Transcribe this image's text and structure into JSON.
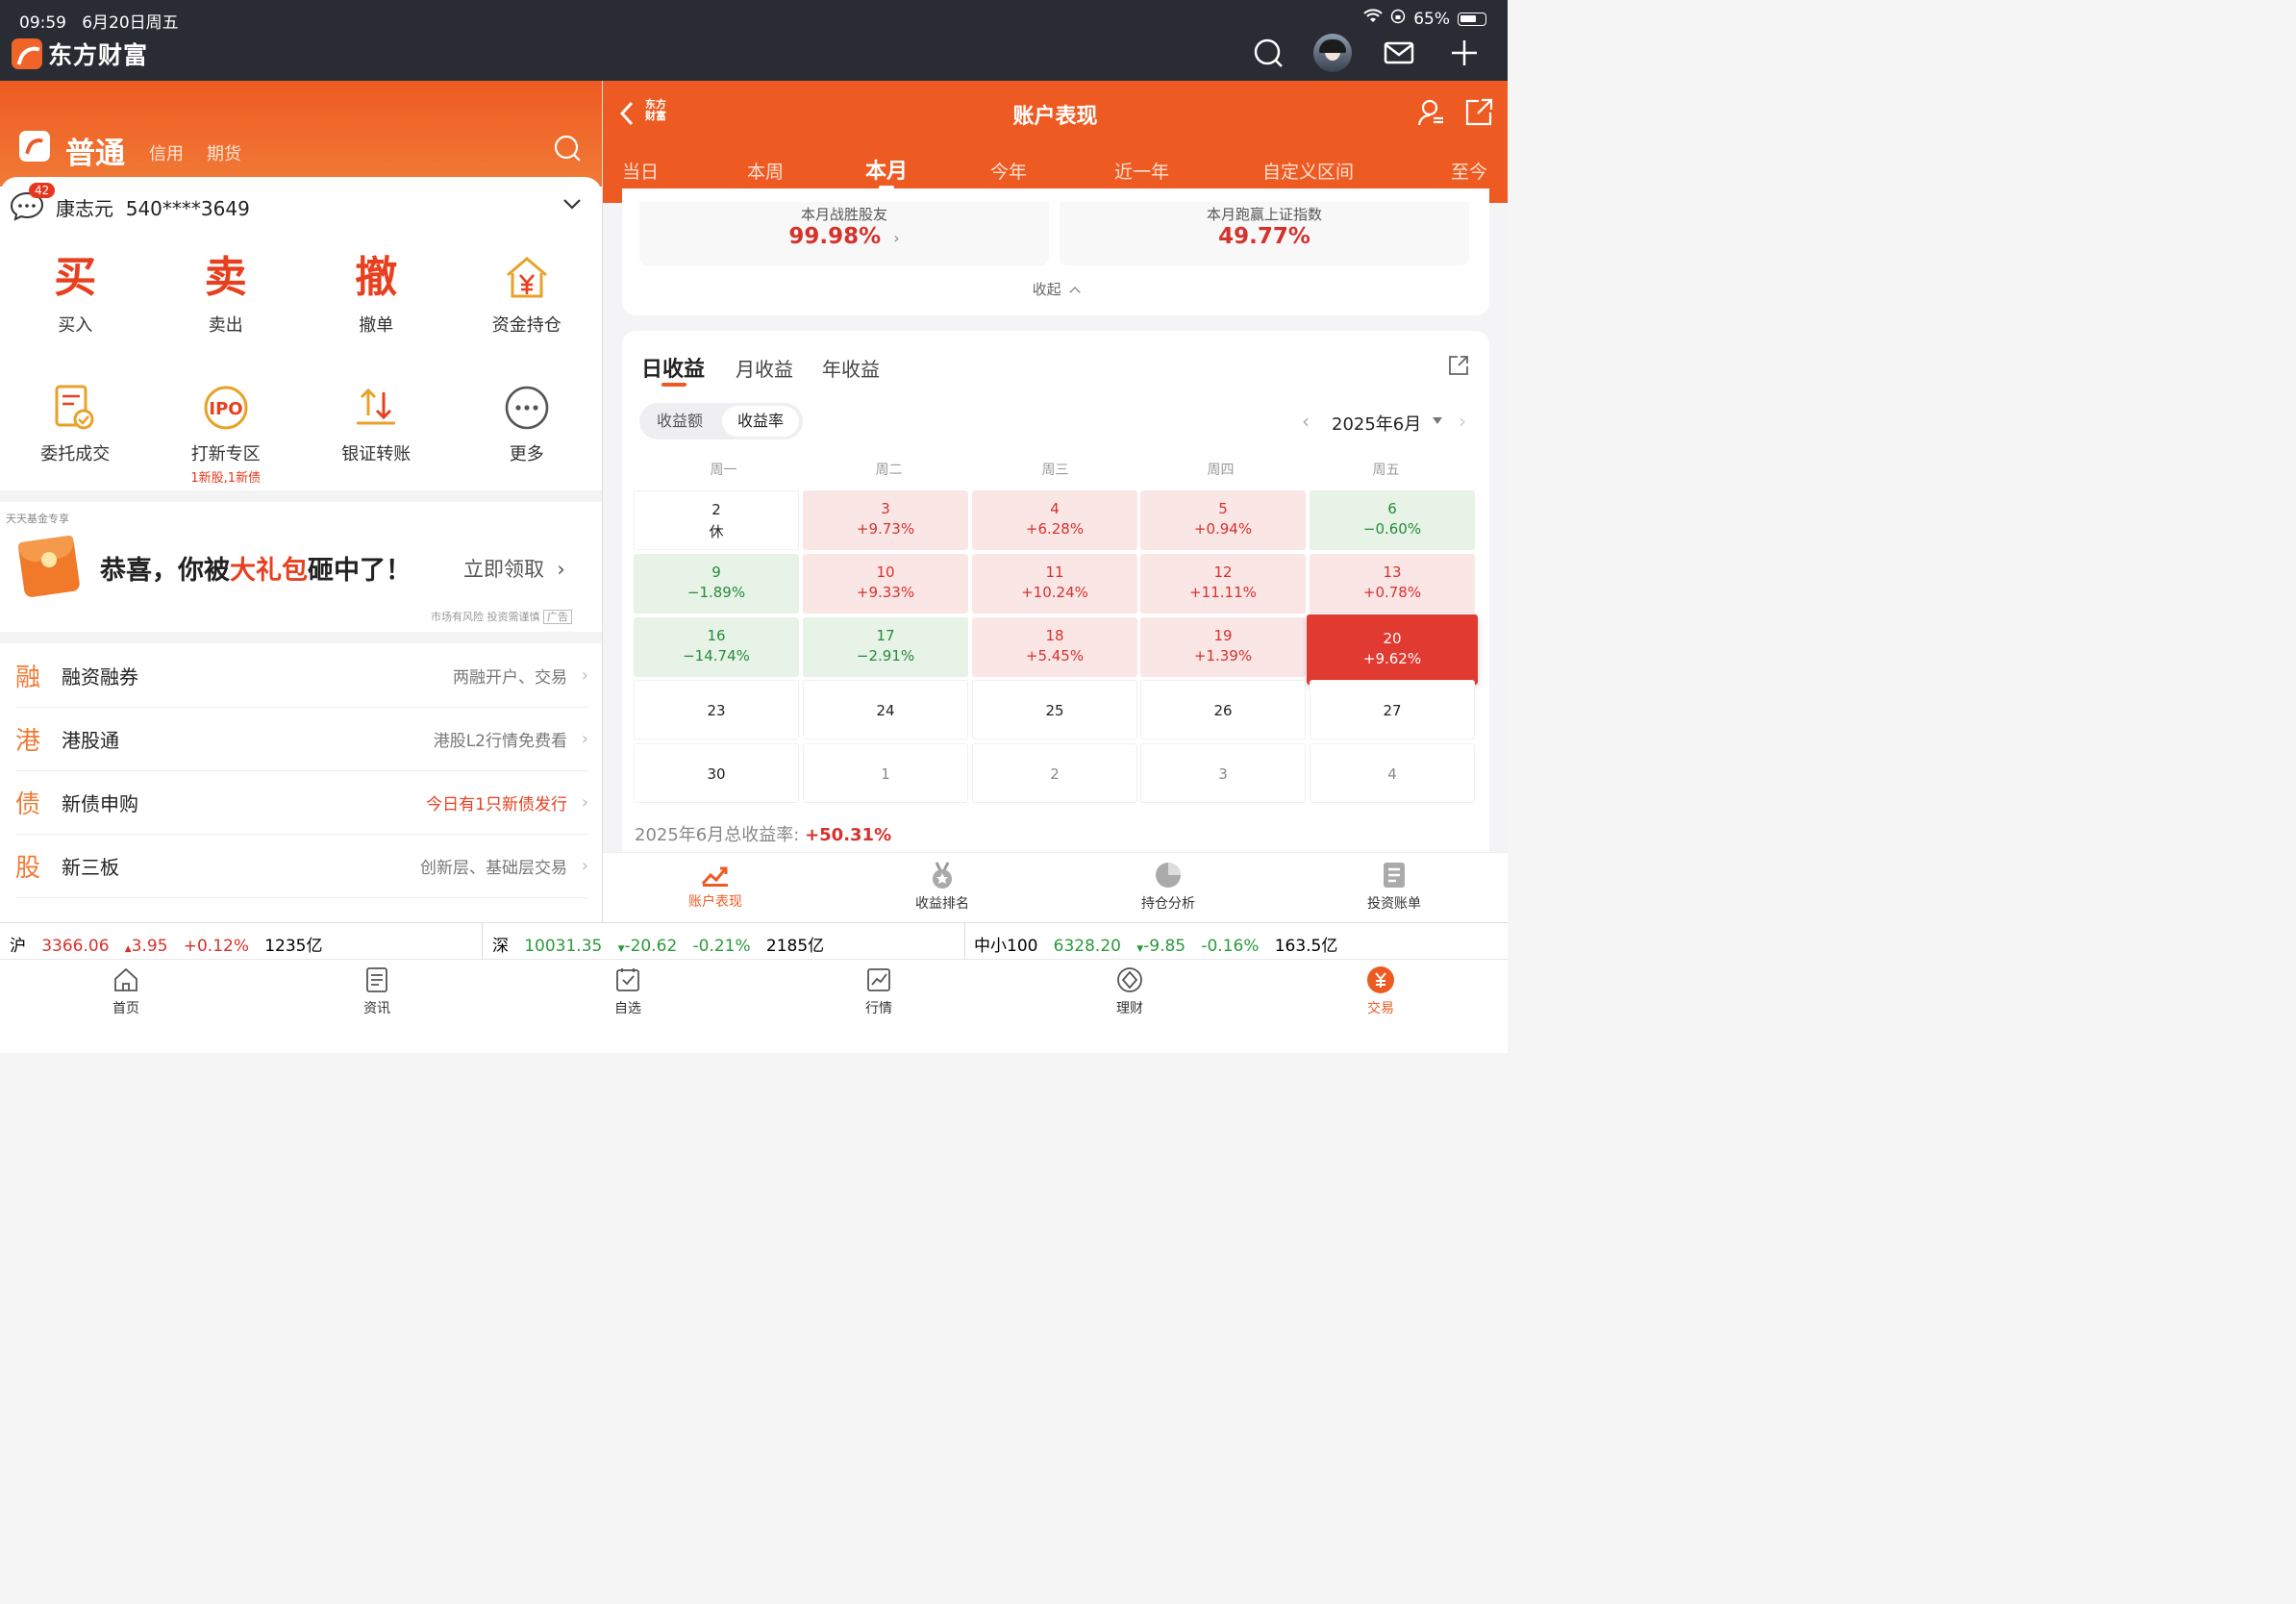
{
  "status": {
    "time": "09:59",
    "date": "6月20日周五",
    "battery": "65%"
  },
  "app": {
    "name": "东方财富"
  },
  "left": {
    "tabs": {
      "main": "普通",
      "credit": "信用",
      "futures": "期货"
    },
    "account": {
      "badge": "42",
      "name": "康志元",
      "number": "540****3649"
    },
    "actions": [
      {
        "char": "买",
        "label": "买入"
      },
      {
        "char": "卖",
        "label": "卖出"
      },
      {
        "char": "撤",
        "label": "撤单"
      },
      {
        "label": "资金持仓"
      }
    ],
    "actions2": [
      {
        "label": "委托成交"
      },
      {
        "label": "打新专区",
        "sub": "1新股,1新债"
      },
      {
        "label": "银证转账"
      },
      {
        "label": "更多"
      }
    ],
    "promo": {
      "source": "天天基金专享",
      "text_a": "恭喜，你被",
      "text_b": "大礼包",
      "text_c": "砸中了！",
      "cta": "立即领取",
      "disclaimer": "市场有风险 投资需谨慎",
      "ad": "广告"
    },
    "list": [
      {
        "icon": "融",
        "name": "融资融券",
        "hint": "两融开户、交易"
      },
      {
        "icon": "港",
        "name": "港股通",
        "hint": "港股L2行情免费看"
      },
      {
        "icon": "债",
        "name": "新债申购",
        "hint": "今日有1只新债发行"
      },
      {
        "icon": "股",
        "name": "新三板",
        "hint": "创新层、基础层交易"
      }
    ]
  },
  "right": {
    "title": "账户表现",
    "period_tabs": [
      "当日",
      "本周",
      "本月",
      "今年",
      "近一年",
      "自定义区间",
      "至今"
    ],
    "summary": {
      "beat_label": "本月战胜股友",
      "beat_value": "99.98%",
      "index_label": "本月跑赢上证指数",
      "index_value": "49.77%",
      "collapse": "收起"
    },
    "profit_tabs": [
      "日收益",
      "月收益",
      "年收益"
    ],
    "toggle": {
      "amount": "收益额",
      "rate": "收益率"
    },
    "month": "2025年6月",
    "weekdays": [
      "周一",
      "周二",
      "周三",
      "周四",
      "周五"
    ],
    "days": [
      {
        "n": "2",
        "v": "休"
      },
      {
        "n": "3",
        "v": "+9.73%"
      },
      {
        "n": "4",
        "v": "+6.28%"
      },
      {
        "n": "5",
        "v": "+0.94%"
      },
      {
        "n": "6",
        "v": "−0.60%"
      },
      {
        "n": "9",
        "v": "−1.89%"
      },
      {
        "n": "10",
        "v": "+9.33%"
      },
      {
        "n": "11",
        "v": "+10.24%"
      },
      {
        "n": "12",
        "v": "+11.11%"
      },
      {
        "n": "13",
        "v": "+0.78%"
      },
      {
        "n": "16",
        "v": "−14.74%"
      },
      {
        "n": "17",
        "v": "−2.91%"
      },
      {
        "n": "18",
        "v": "+5.45%"
      },
      {
        "n": "19",
        "v": "+1.39%"
      },
      {
        "n": "20",
        "v": "+9.62%"
      },
      {
        "n": "23",
        "v": ""
      },
      {
        "n": "24",
        "v": ""
      },
      {
        "n": "25",
        "v": ""
      },
      {
        "n": "26",
        "v": ""
      },
      {
        "n": "27",
        "v": ""
      },
      {
        "n": "30",
        "v": ""
      },
      {
        "n": "1",
        "v": ""
      },
      {
        "n": "2",
        "v": ""
      },
      {
        "n": "3",
        "v": ""
      },
      {
        "n": "4",
        "v": ""
      }
    ],
    "total_label": "2025年6月总收益率:",
    "total_value": "+50.31%",
    "bottom_tabs": [
      "账户表现",
      "收益排名",
      "持仓分析",
      "投资账单"
    ]
  },
  "ticker": [
    {
      "name": "沪",
      "price": "3366.06",
      "chg": "3.95",
      "pct": "+0.12%",
      "vol": "1235亿"
    },
    {
      "name": "深",
      "price": "10031.35",
      "chg": "-20.62",
      "pct": "-0.21%",
      "vol": "2185亿"
    },
    {
      "name": "中小100",
      "price": "6328.20",
      "chg": "-9.85",
      "pct": "-0.16%",
      "vol": "163.5亿"
    }
  ],
  "bottom_nav": [
    "首页",
    "资讯",
    "自选",
    "行情",
    "理财",
    "交易"
  ],
  "colors": {
    "brand": "#ee5b22",
    "up": "#d6322c",
    "down": "#2a9a3a"
  }
}
